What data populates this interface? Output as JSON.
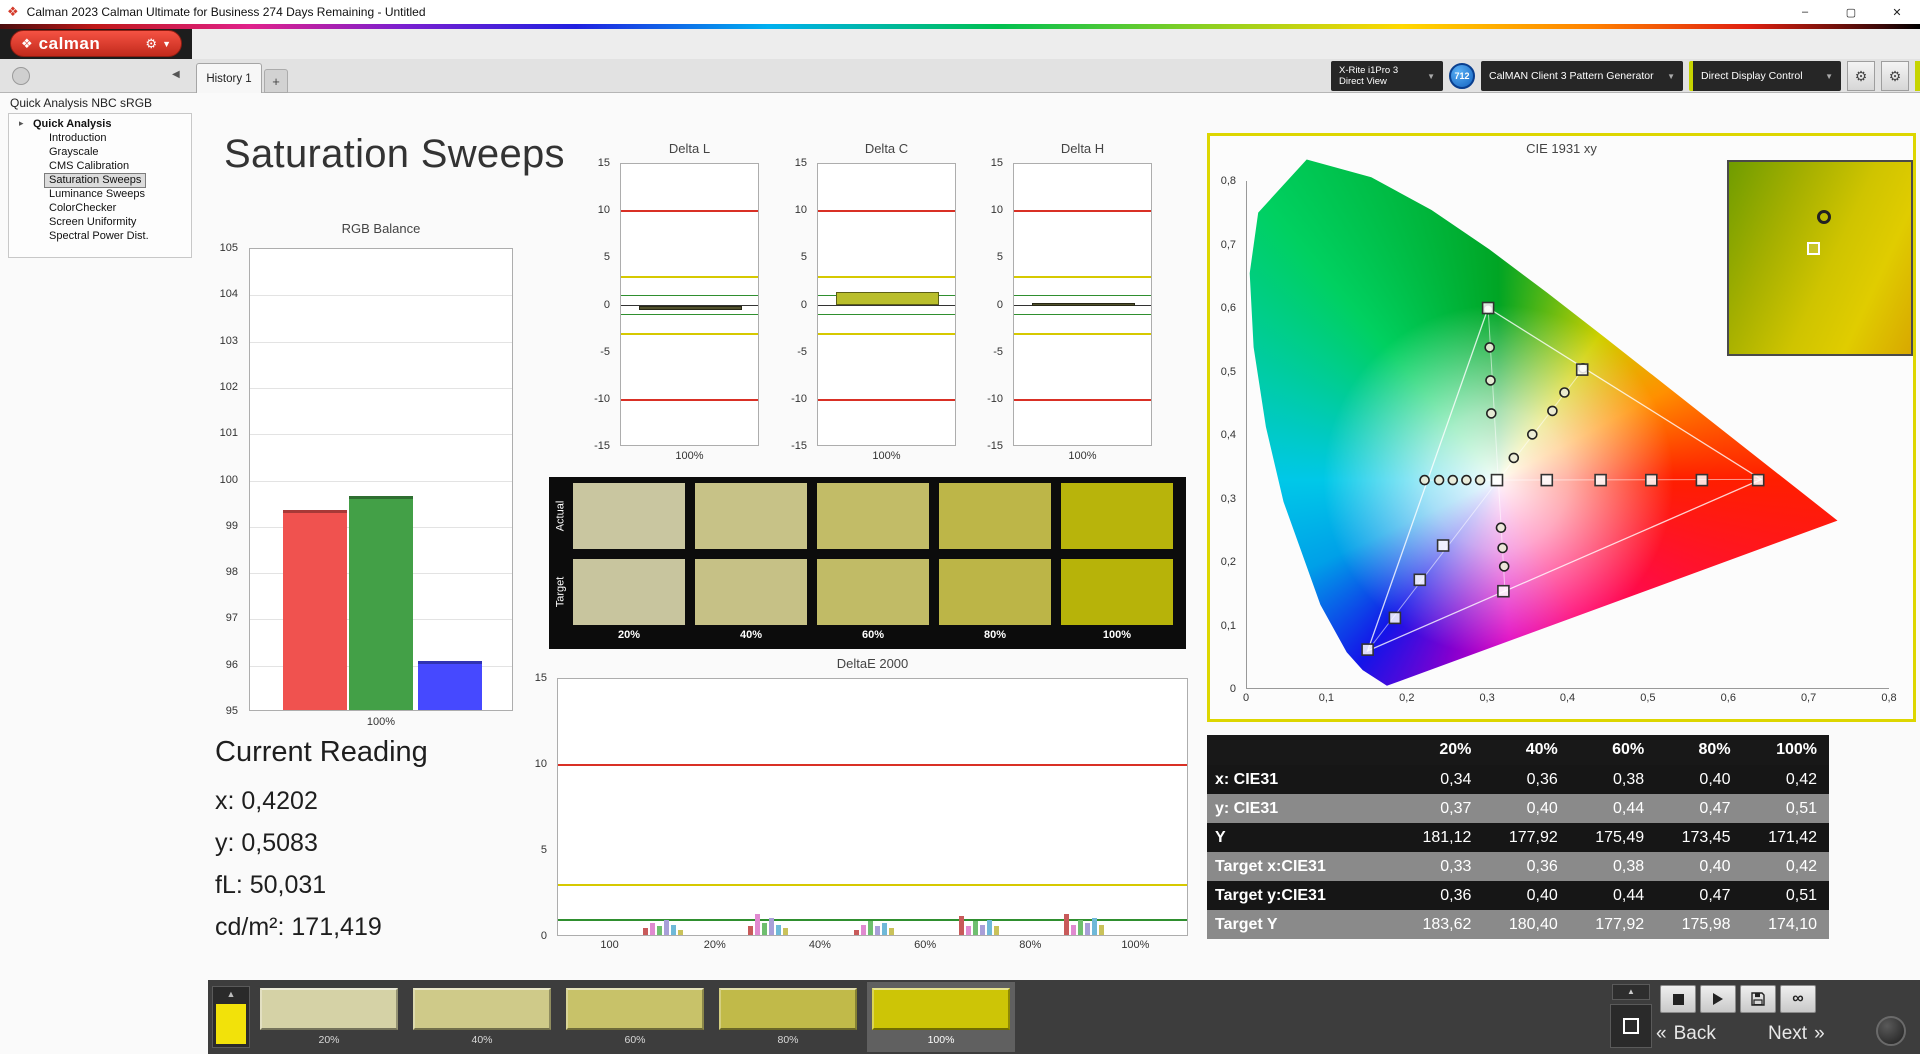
{
  "window": {
    "title": "Calman 2023 Calman Ultimate for Business 274 Days Remaining  - Untitled",
    "controls": {
      "minimize": "–",
      "maximize": "▢",
      "close": "✕"
    }
  },
  "logo": {
    "text": "calman"
  },
  "tabs": {
    "active": "History 1",
    "add_tab": "+"
  },
  "device_bar": {
    "meter_line1": "X-Rite i1Pro 3",
    "meter_line2": "Direct View",
    "badge": "712",
    "pattern_generator": "CalMAN Client 3 Pattern Generator",
    "display_control": "Direct Display Control"
  },
  "sidebar": {
    "header": "Quick Analysis NBC sRGB",
    "root": "Quick Analysis",
    "items": [
      "Introduction",
      "Grayscale",
      "CMS Calibration",
      "Saturation Sweeps",
      "Luminance Sweeps",
      "ColorChecker",
      "Screen Uniformity",
      "Spectral Power Dist."
    ],
    "selected": "Saturation Sweeps"
  },
  "page": {
    "title": "Saturation Sweeps"
  },
  "current_reading": {
    "heading": "Current Reading",
    "lines": [
      "x: 0,4202",
      "y: 0,5083",
      "fL: 50,031",
      "cd/m²: 171,419"
    ]
  },
  "swatch_grid": {
    "row_labels": [
      "Actual",
      "Target"
    ],
    "columns": [
      "20%",
      "40%",
      "60%",
      "80%",
      "100%"
    ],
    "actual_colors": [
      "#c9c6a0",
      "#c7c287",
      "#c2bc67",
      "#bdb648",
      "#b8b40b"
    ],
    "target_colors": [
      "#c8c59e",
      "#c6c186",
      "#c1bb66",
      "#bcb547",
      "#b7b309"
    ]
  },
  "table": {
    "headers": [
      "20%",
      "40%",
      "60%",
      "80%",
      "100%"
    ],
    "rows": [
      {
        "label": "x: CIE31",
        "values": [
          "0,34",
          "0,36",
          "0,38",
          "0,40",
          "0,42"
        ]
      },
      {
        "label": "y: CIE31",
        "values": [
          "0,37",
          "0,40",
          "0,44",
          "0,47",
          "0,51"
        ]
      },
      {
        "label": "Y",
        "values": [
          "181,12",
          "177,92",
          "175,49",
          "173,45",
          "171,42"
        ]
      },
      {
        "label": "Target x:CIE31",
        "values": [
          "0,33",
          "0,36",
          "0,38",
          "0,40",
          "0,42"
        ]
      },
      {
        "label": "Target y:CIE31",
        "values": [
          "0,36",
          "0,40",
          "0,44",
          "0,47",
          "0,51"
        ]
      },
      {
        "label": "Target Y",
        "values": [
          "183,62",
          "180,40",
          "177,92",
          "175,98",
          "174,10"
        ]
      }
    ]
  },
  "bottom_bar": {
    "levels": [
      {
        "label": "20%",
        "color": "#d5d2a6",
        "selected": false
      },
      {
        "label": "40%",
        "color": "#cfca89",
        "selected": false
      },
      {
        "label": "60%",
        "color": "#c8c269",
        "selected": false
      },
      {
        "label": "80%",
        "color": "#c1ba49",
        "selected": false
      },
      {
        "label": "100%",
        "color": "#cdc506",
        "selected": true
      }
    ],
    "preview_color": "#f2e20a",
    "back_arrow": "«",
    "back": "Back",
    "next": "Next",
    "next_arrow": "»"
  },
  "chart_data": [
    {
      "id": "rgb_balance",
      "type": "bar",
      "title": "RGB Balance",
      "categories": [
        "Red",
        "Green",
        "Blue"
      ],
      "values": [
        99.33,
        99.62,
        96.05
      ],
      "colors": [
        "#f0524f",
        "#43a047",
        "#4649ff"
      ],
      "ylim": [
        95,
        105
      ],
      "ystep": 1,
      "xlabel": "100%"
    },
    {
      "id": "delta_l",
      "type": "delta-bar",
      "title": "Delta L",
      "value": -0.5,
      "bar_color": "#50502c",
      "ylim": [
        -15,
        15
      ],
      "ystep": 5,
      "xlabel": "100%",
      "ref_lines": [
        {
          "y": 10,
          "color": "#d93025"
        },
        {
          "y": 3,
          "color": "#d6c900"
        },
        {
          "y": 1,
          "color": "#2f8f2f"
        },
        {
          "y": -1,
          "color": "#2f8f2f"
        },
        {
          "y": -3,
          "color": "#d6c900"
        },
        {
          "y": -10,
          "color": "#d93025"
        }
      ]
    },
    {
      "id": "delta_c",
      "type": "delta-bar",
      "title": "Delta C",
      "value": 1.4,
      "bar_color": "#b9be2c",
      "ylim": [
        -15,
        15
      ],
      "ystep": 5,
      "xlabel": "100%",
      "ref_lines": [
        {
          "y": 10,
          "color": "#d93025"
        },
        {
          "y": 3,
          "color": "#d6c900"
        },
        {
          "y": 1,
          "color": "#2f8f2f"
        },
        {
          "y": -1,
          "color": "#2f8f2f"
        },
        {
          "y": -3,
          "color": "#d6c900"
        },
        {
          "y": -10,
          "color": "#d93025"
        }
      ]
    },
    {
      "id": "delta_h",
      "type": "delta-bar",
      "title": "Delta H",
      "value": 0.25,
      "bar_color": "#50502c",
      "ylim": [
        -15,
        15
      ],
      "ystep": 5,
      "xlabel": "100%",
      "ref_lines": [
        {
          "y": 10,
          "color": "#d93025"
        },
        {
          "y": 3,
          "color": "#d6c900"
        },
        {
          "y": 1,
          "color": "#2f8f2f"
        },
        {
          "y": -1,
          "color": "#2f8f2f"
        },
        {
          "y": -3,
          "color": "#d6c900"
        },
        {
          "y": -10,
          "color": "#d93025"
        }
      ]
    },
    {
      "id": "deltae2000",
      "type": "grouped-bar",
      "title": "DeltaE 2000",
      "ylim": [
        0,
        15
      ],
      "yticks": [
        0,
        5,
        10,
        15
      ],
      "x_tick_labels": [
        "100",
        "20%",
        "40%",
        "60%",
        "80%",
        "100%"
      ],
      "ref_lines": [
        {
          "y": 10,
          "color": "#d93025"
        },
        {
          "y": 3,
          "color": "#d6c900"
        },
        {
          "y": 1,
          "color": "#2f8f2f"
        }
      ],
      "palette": [
        "#c85a5a",
        "#e08ad0",
        "#6fbf6f",
        "#a89fd8",
        "#6fb9d8",
        "#c9c25a"
      ],
      "groups": [
        [
          0.4,
          0.7,
          0.5,
          0.9,
          0.6,
          0.3
        ],
        [
          0.5,
          1.2,
          0.7,
          1.0,
          0.6,
          0.4
        ],
        [
          0.3,
          0.6,
          0.8,
          0.5,
          0.7,
          0.4
        ],
        [
          1.1,
          0.5,
          0.8,
          0.6,
          0.9,
          0.5
        ],
        [
          1.2,
          0.6,
          0.9,
          0.7,
          1.0,
          0.6
        ]
      ]
    },
    {
      "id": "cie",
      "type": "scatter",
      "title": "CIE 1931 xy",
      "xlim": [
        0,
        0.8
      ],
      "ylim": [
        0,
        0.8
      ],
      "tick_step": 0.1,
      "white_point": [
        0.3127,
        0.329
      ],
      "srgb_triangle": [
        [
          0.64,
          0.33
        ],
        [
          0.3,
          0.6
        ],
        [
          0.15,
          0.06
        ]
      ],
      "secondaries": [
        [
          0.419,
          0.505
        ],
        [
          0.321,
          0.154
        ],
        [
          0.225,
          0.329
        ]
      ],
      "target_squares": [
        [
          0.373,
          0.329
        ],
        [
          0.44,
          0.329
        ],
        [
          0.503,
          0.329
        ],
        [
          0.566,
          0.329
        ],
        [
          0.636,
          0.329
        ],
        [
          0.3,
          0.6
        ],
        [
          0.417,
          0.503
        ],
        [
          0.244,
          0.226
        ],
        [
          0.215,
          0.172
        ],
        [
          0.184,
          0.112
        ],
        [
          0.15,
          0.062
        ],
        [
          0.319,
          0.154
        ],
        [
          0.311,
          0.329
        ]
      ],
      "measured_circles": [
        [
          0.332,
          0.364
        ],
        [
          0.355,
          0.401
        ],
        [
          0.38,
          0.438
        ],
        [
          0.395,
          0.467
        ],
        [
          0.418,
          0.505
        ],
        [
          0.304,
          0.434
        ],
        [
          0.303,
          0.486
        ],
        [
          0.302,
          0.538
        ],
        [
          0.3,
          0.598
        ],
        [
          0.221,
          0.329
        ],
        [
          0.239,
          0.329
        ],
        [
          0.256,
          0.329
        ],
        [
          0.273,
          0.329
        ],
        [
          0.29,
          0.329
        ],
        [
          0.316,
          0.254
        ],
        [
          0.318,
          0.222
        ],
        [
          0.32,
          0.193
        ]
      ]
    }
  ]
}
